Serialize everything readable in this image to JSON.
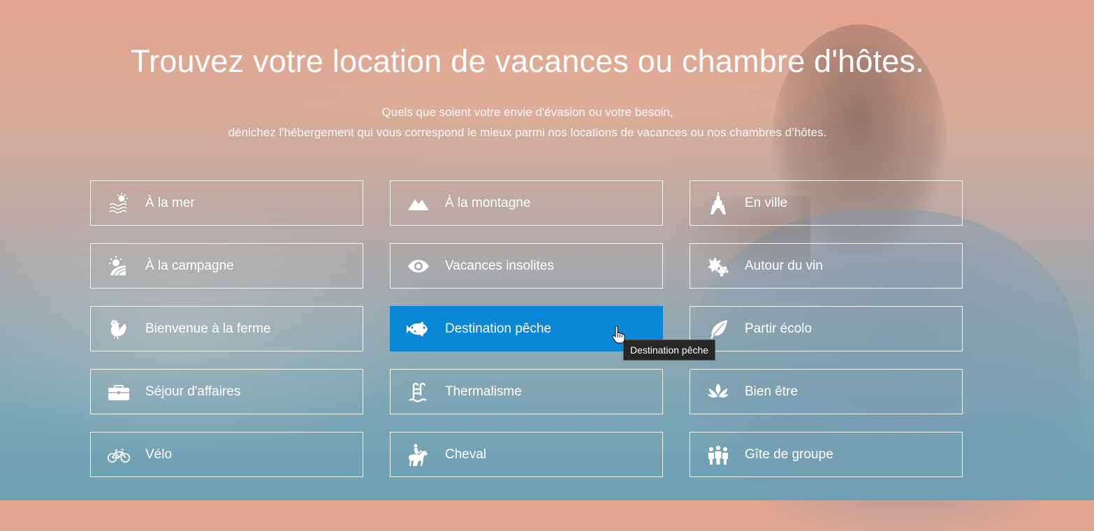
{
  "hero": {
    "title": "Trouvez votre location de vacances ou chambre d'hôtes.",
    "subtitle_line1": "Quels que soient votre envie d'évasion ou votre besoin,",
    "subtitle_line2": "dénichez l'hébergement qui vous correspond le mieux parmi nos locations de vacances ou nos chambres d’hôtes."
  },
  "categories": [
    {
      "label": "À la mer",
      "icon": "sea-icon"
    },
    {
      "label": "À la montagne",
      "icon": "mountain-icon"
    },
    {
      "label": "En ville",
      "icon": "eiffel-tower-icon"
    },
    {
      "label": "À la campagne",
      "icon": "countryside-icon"
    },
    {
      "label": "Vacances insolites",
      "icon": "eye-icon"
    },
    {
      "label": "Autour du vin",
      "icon": "grapes-icon"
    },
    {
      "label": "Bienvenue à la ferme",
      "icon": "rooster-icon"
    },
    {
      "label": "Destination pêche",
      "icon": "fish-icon",
      "active": true
    },
    {
      "label": "Partir écolo",
      "icon": "leaf-icon"
    },
    {
      "label": "Séjour d'affaires",
      "icon": "briefcase-icon"
    },
    {
      "label": "Thermalisme",
      "icon": "pool-ladder-icon"
    },
    {
      "label": "Bien être",
      "icon": "lotus-icon"
    },
    {
      "label": "Vélo",
      "icon": "bicycle-icon"
    },
    {
      "label": "Cheval",
      "icon": "horse-rider-icon"
    },
    {
      "label": "Gîte de groupe",
      "icon": "group-icon"
    }
  ],
  "tooltip": {
    "text": "Destination pêche"
  },
  "colors": {
    "active_tile": "#0a87d6",
    "tooltip_bg": "#262626"
  }
}
